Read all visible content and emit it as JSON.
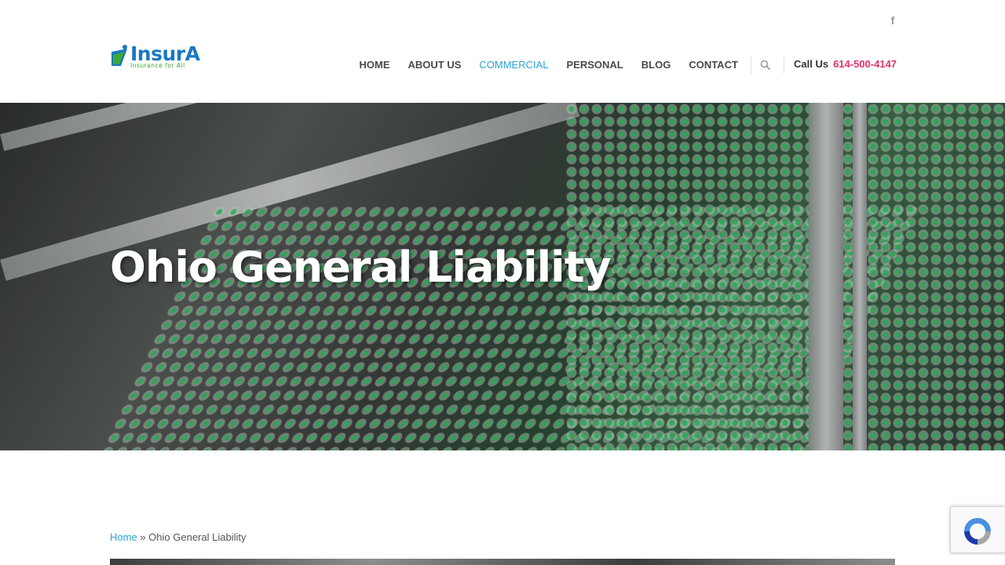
{
  "topbar": {
    "social_icon": "facebook-icon"
  },
  "brand": {
    "name": "InsurA",
    "tagline": "Insurance for All",
    "logo_icon": "logo-mark-icon"
  },
  "nav": {
    "items": [
      {
        "label": "HOME",
        "active": false
      },
      {
        "label": "ABOUT US",
        "active": false
      },
      {
        "label": "COMMERCIAL",
        "active": true
      },
      {
        "label": "PERSONAL",
        "active": false
      },
      {
        "label": "BLOG",
        "active": false
      },
      {
        "label": "CONTACT",
        "active": false
      }
    ],
    "search_icon": "search-icon"
  },
  "contact": {
    "label": "Call Us",
    "phone": "614-500-4147"
  },
  "hero": {
    "title": "Ohio General Liability"
  },
  "breadcrumb": {
    "home": "Home",
    "separator": "»",
    "current": "Ohio General Liability"
  },
  "recaptcha": {
    "icon": "recaptcha-icon"
  },
  "colors": {
    "accent": "#2aa3d6",
    "phone": "#e0316e",
    "brand_blue": "#1a78c2",
    "brand_green": "#3aa935"
  }
}
